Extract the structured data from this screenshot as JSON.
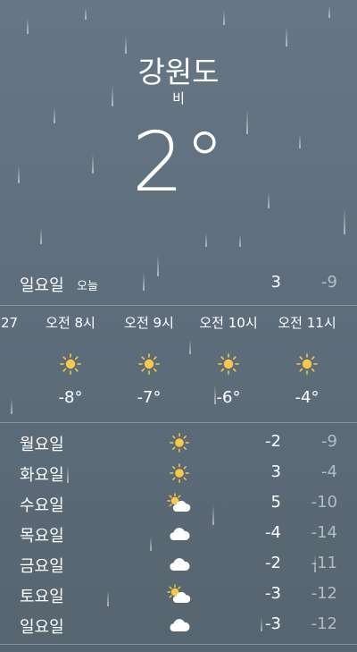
{
  "location": {
    "city": "강원도",
    "condition": "비",
    "temperature": "2°"
  },
  "today": {
    "day": "일요일",
    "label": "오늘",
    "high": "3",
    "low": "-9"
  },
  "hourly": [
    {
      "time": ":27",
      "icon": "sun-icon",
      "temp": ""
    },
    {
      "time": "오전 8시",
      "icon": "sun-icon",
      "temp": "-8°"
    },
    {
      "time": "오전 9시",
      "icon": "sun-icon",
      "temp": "-7°"
    },
    {
      "time": "오전 10시",
      "icon": "sun-icon",
      "temp": "-6°"
    },
    {
      "time": "오전 11시",
      "icon": "sun-icon",
      "temp": "-4°"
    }
  ],
  "daily": [
    {
      "day": "월요일",
      "icon": "sun-icon",
      "high": "-2",
      "low": "-9"
    },
    {
      "day": "화요일",
      "icon": "sun-icon",
      "high": "3",
      "low": "-4"
    },
    {
      "day": "수요일",
      "icon": "partly-cloudy-icon",
      "high": "5",
      "low": "-10"
    },
    {
      "day": "목요일",
      "icon": "cloud-icon",
      "high": "-4",
      "low": "-14"
    },
    {
      "day": "금요일",
      "icon": "cloud-icon",
      "high": "-2",
      "low": "-11"
    },
    {
      "day": "토요일",
      "icon": "partly-cloudy-icon",
      "high": "-3",
      "low": "-12"
    },
    {
      "day": "일요일",
      "icon": "cloud-icon",
      "high": "-3",
      "low": "-12"
    }
  ],
  "colors": {
    "sun": "#f7c948",
    "cloud": "#ffffff",
    "background": "#5f6f7d"
  }
}
